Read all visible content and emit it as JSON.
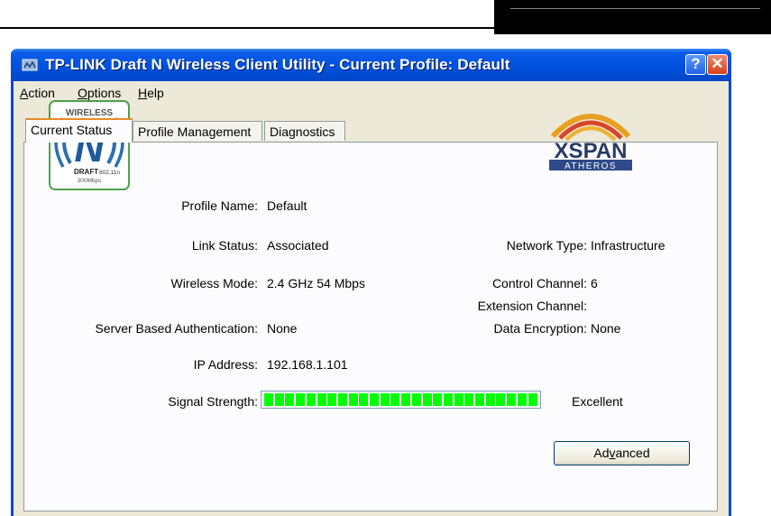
{
  "window": {
    "title": "TP-LINK Draft N Wireless Client Utility - Current Profile: Default",
    "help_symbol": "?",
    "close_symbol": "✕"
  },
  "menu": [
    {
      "pre": "",
      "key": "A",
      "post": "ction"
    },
    {
      "pre": "",
      "key": "O",
      "post": "ptions"
    },
    {
      "pre": "",
      "key": "H",
      "post": "elp"
    }
  ],
  "tabs": [
    "Current Status",
    "Profile Management",
    "Diagnostics"
  ],
  "logos": {
    "wireless_top": "WIRELESS",
    "wireless_letter": "N",
    "wireless_draft": "DRAFT",
    "wireless_std": "802.11n",
    "wireless_speed": "300Mbps",
    "xspan_word": "XSPAN",
    "atheros_word": "ATHEROS"
  },
  "status": {
    "profile_name_label": "Profile Name:",
    "profile_name": "Default",
    "link_status_label": "Link Status:",
    "link_status": "Associated",
    "wireless_mode_label": "Wireless Mode:",
    "wireless_mode": "2.4 GHz 54 Mbps",
    "server_auth_label": "Server Based Authentication:",
    "server_auth": "None",
    "ip_label": "IP Address:",
    "ip": "192.168.1.101",
    "signal_label": "Signal Strength:",
    "signal_text": "Excellent",
    "signal_segments": 26,
    "network_type_label": "Network Type:",
    "network_type": "Infrastructure",
    "control_channel_label": "Control Channel:",
    "control_channel": "6",
    "extension_channel_label": "Extension Channel:",
    "extension_channel": "",
    "data_encryption_label": "Data Encryption:",
    "data_encryption": "None"
  },
  "buttons": {
    "advanced_pre": "Ad",
    "advanced_key": "v",
    "advanced_post": "anced"
  },
  "colors": {
    "signal": "#00ff00",
    "title_bar": "#0053e0",
    "tab_highlight": "#e68b2c"
  }
}
